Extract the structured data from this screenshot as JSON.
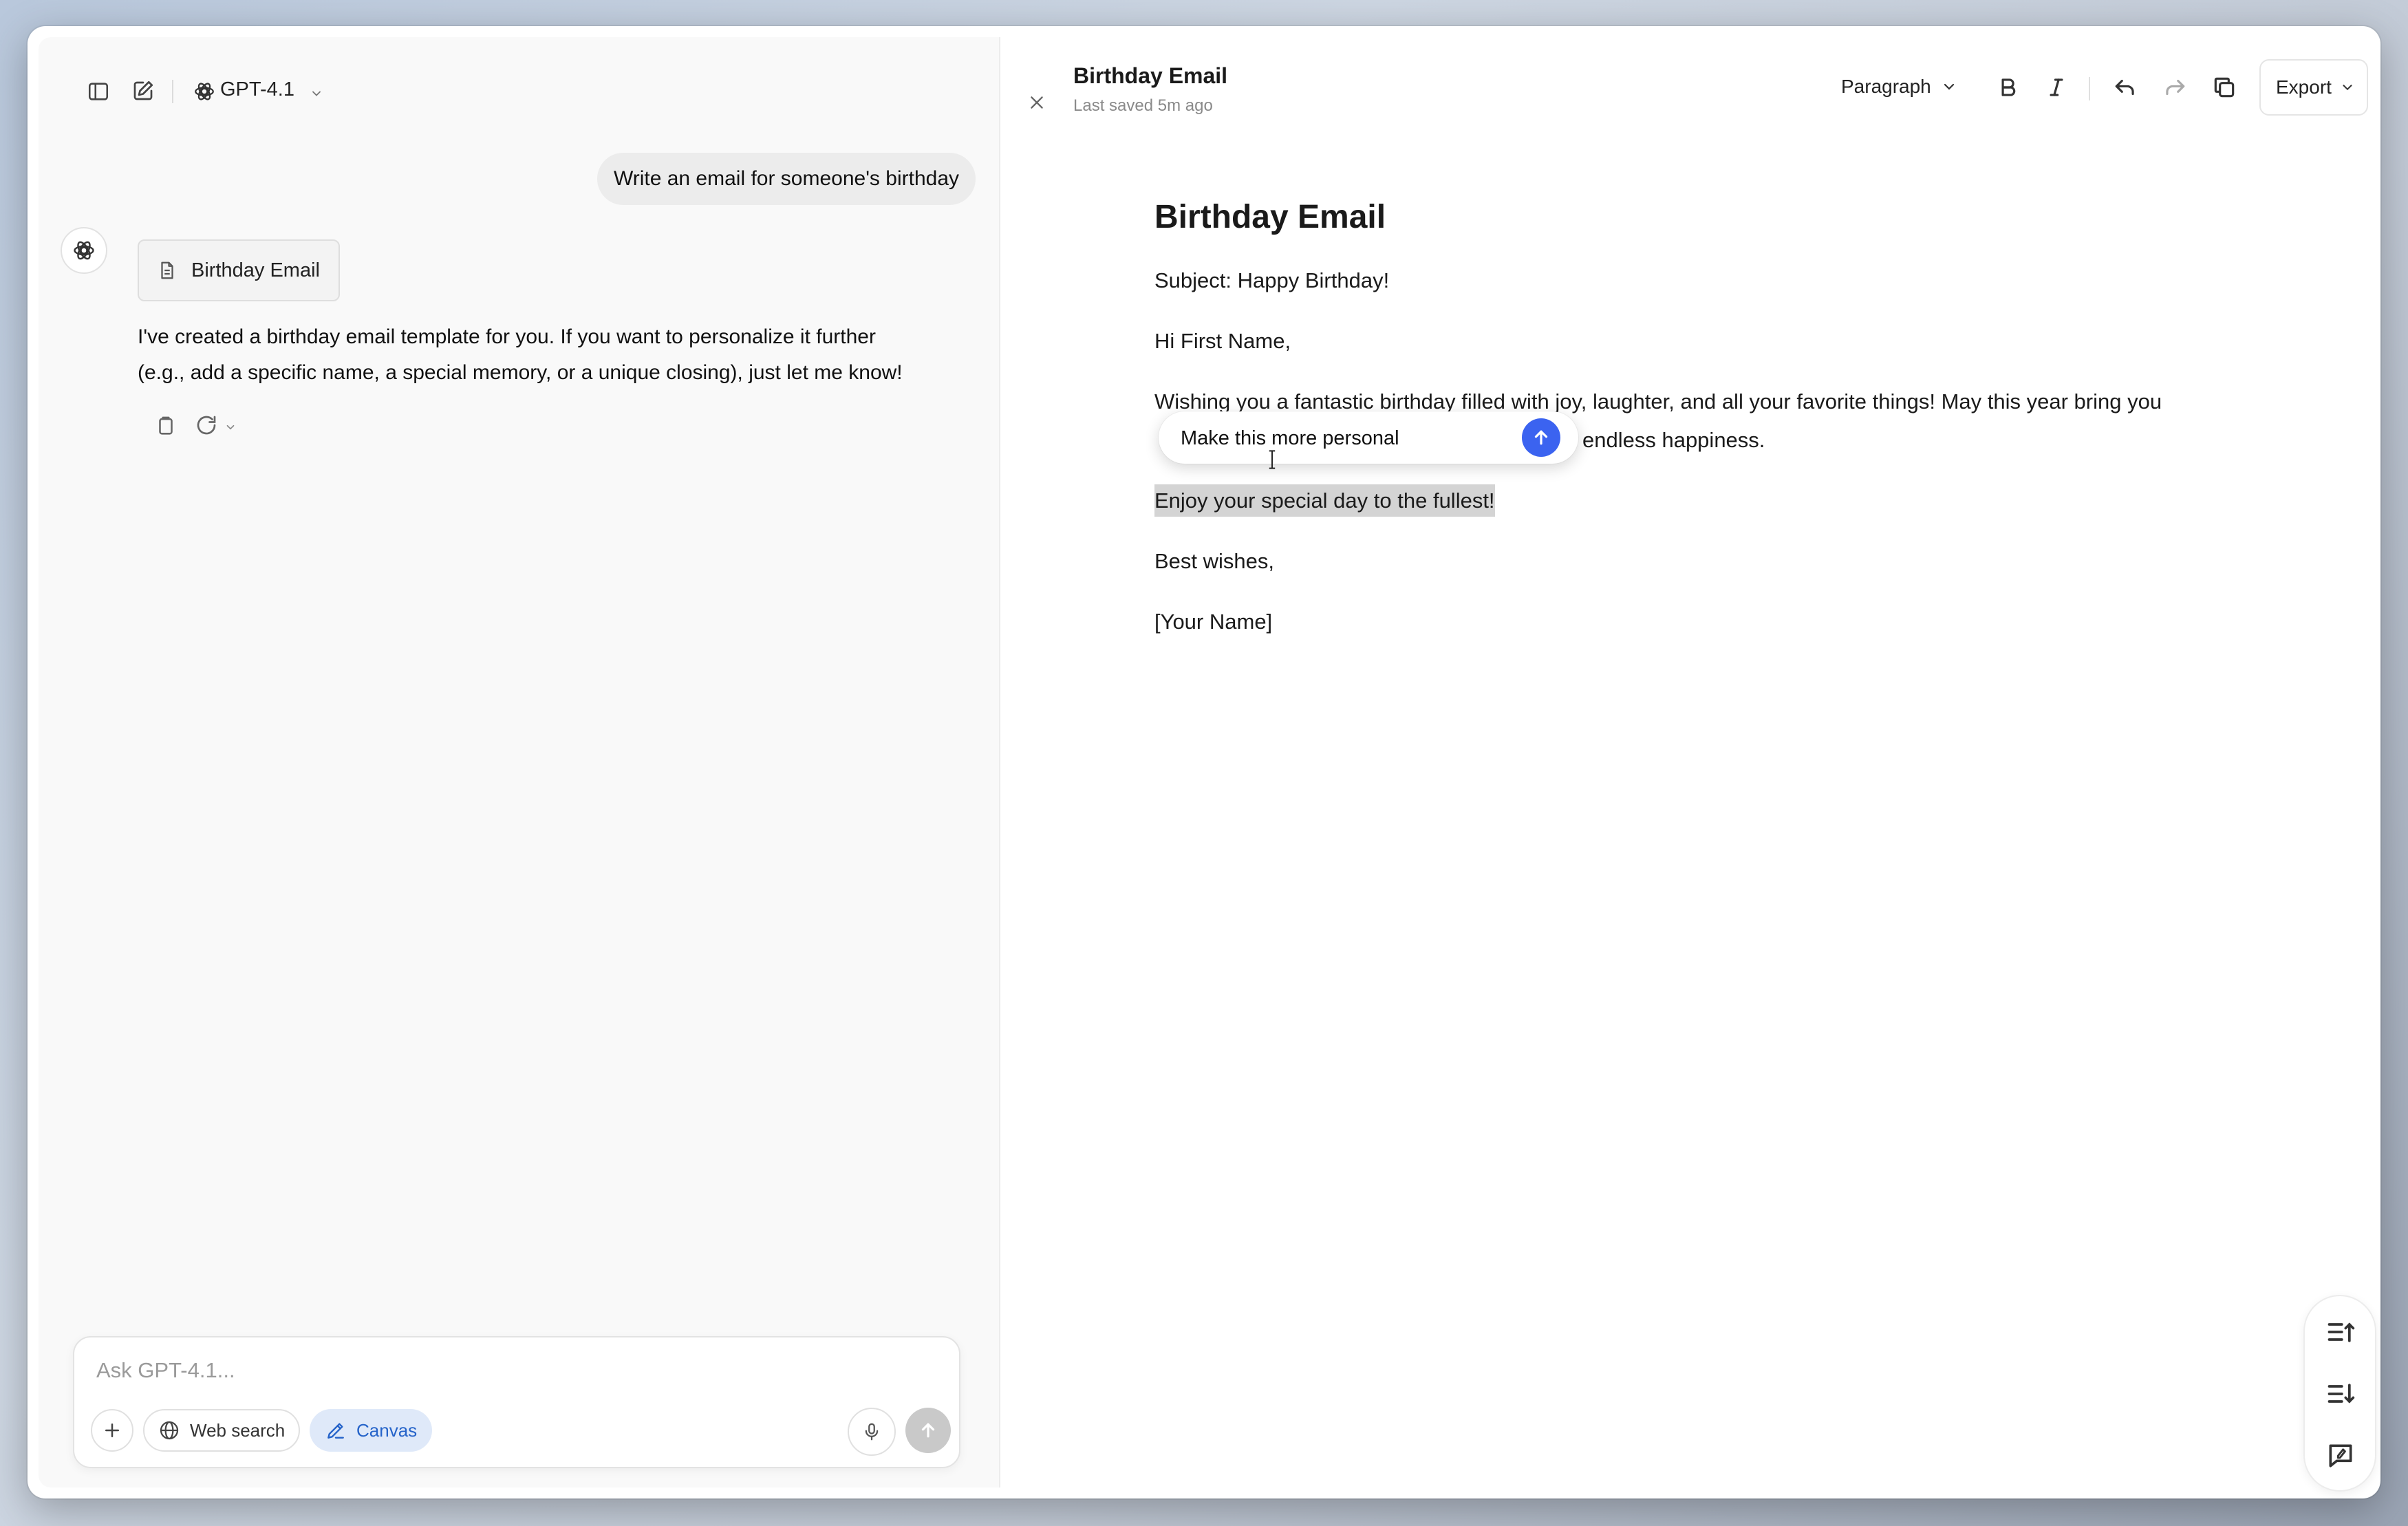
{
  "chat": {
    "model_name": "GPT-4.1",
    "user_message": "Write an email for someone's birthday",
    "doc_chip_label": "Birthday Email",
    "assistant_line1": "I've created a birthday email template for you. If you want to personalize it further",
    "assistant_line2": "(e.g., add a specific name, a special memory, or a unique closing), just let me know!",
    "composer": {
      "placeholder": "Ask GPT-4.1...",
      "web_search_label": "Web search",
      "canvas_label": "Canvas"
    }
  },
  "canvas": {
    "header_title": "Birthday Email",
    "last_saved": "Last saved 5m ago",
    "block_type": "Paragraph",
    "export_label": "Export",
    "document": {
      "heading": "Birthday Email",
      "subject": "Subject: Happy Birthday!",
      "greeting": "Hi First Name,",
      "body_line1": "Wishing you a fantastic birthday filled with joy, laughter, and all your favorite things! May this year bring you",
      "body_line2_tail": "endless happiness.",
      "highlighted": "Enjoy your special day to the fullest!",
      "closing": "Best wishes,",
      "signature": "[Your Name]"
    },
    "inline_prompt": {
      "value": "Make this more personal"
    }
  },
  "colors": {
    "accent_blue": "#3b63f0",
    "canvas_pill_bg": "#dfe9f9",
    "canvas_pill_text": "#2563c9",
    "highlight": "#d4d4d4"
  }
}
